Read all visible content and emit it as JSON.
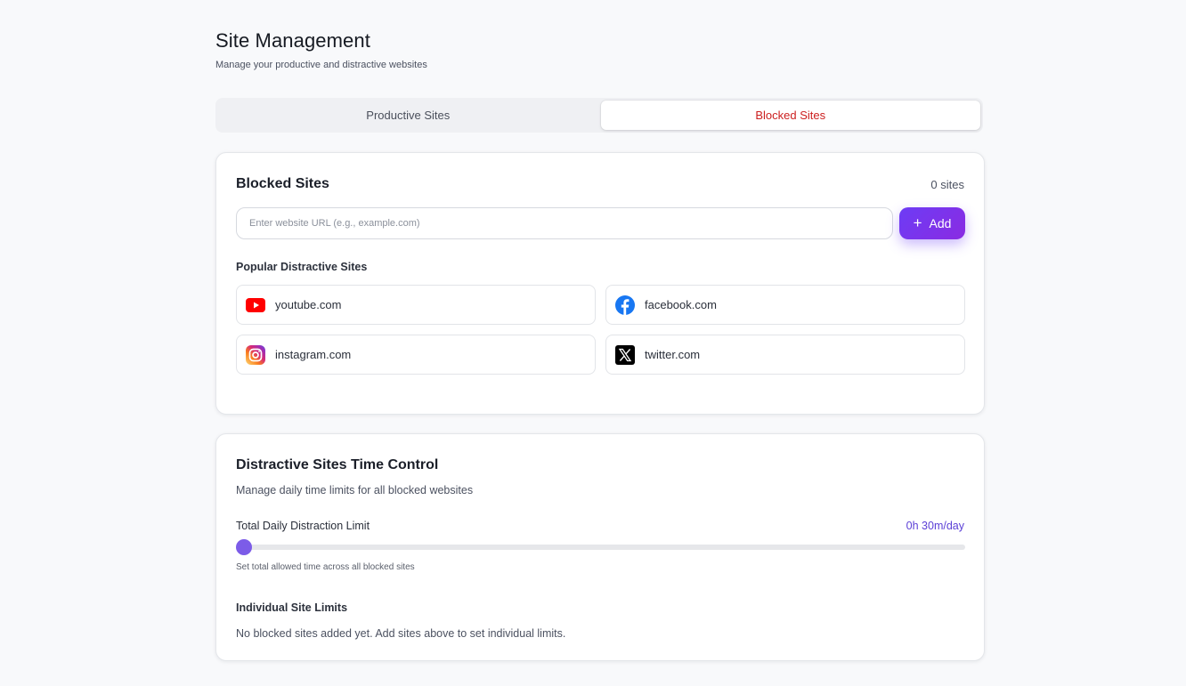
{
  "header": {
    "title": "Site Management",
    "subtitle": "Manage your productive and distractive websites"
  },
  "tabs": [
    {
      "label": "Productive Sites",
      "active": false
    },
    {
      "label": "Blocked Sites",
      "active": true
    }
  ],
  "blocked": {
    "title": "Blocked Sites",
    "count_label": "0 sites",
    "input_placeholder": "Enter website URL (e.g., example.com)",
    "input_value": "",
    "add_label": "Add",
    "popular_label": "Popular Distractive Sites",
    "popular_sites": [
      {
        "name": "youtube.com",
        "icon": "youtube-icon"
      },
      {
        "name": "facebook.com",
        "icon": "facebook-icon"
      },
      {
        "name": "instagram.com",
        "icon": "instagram-icon"
      },
      {
        "name": "twitter.com",
        "icon": "x-twitter-icon"
      }
    ]
  },
  "time_control": {
    "title": "Distractive Sites Time Control",
    "description": "Manage daily time limits for all blocked websites",
    "limit_label": "Total Daily Distraction Limit",
    "limit_value": "0h 30m/day",
    "slider_fraction": 0.0,
    "slider_hint": "Set total allowed time across all blocked sites",
    "individual_label": "Individual Site Limits",
    "empty_message": "No blocked sites added yet. Add sites above to set individual limits."
  },
  "colors": {
    "accent": "#6d3cf5",
    "active_tab_text": "#cc1f1f",
    "limit_value": "#5b3fd6",
    "slider_thumb": "#7c5ce8"
  }
}
